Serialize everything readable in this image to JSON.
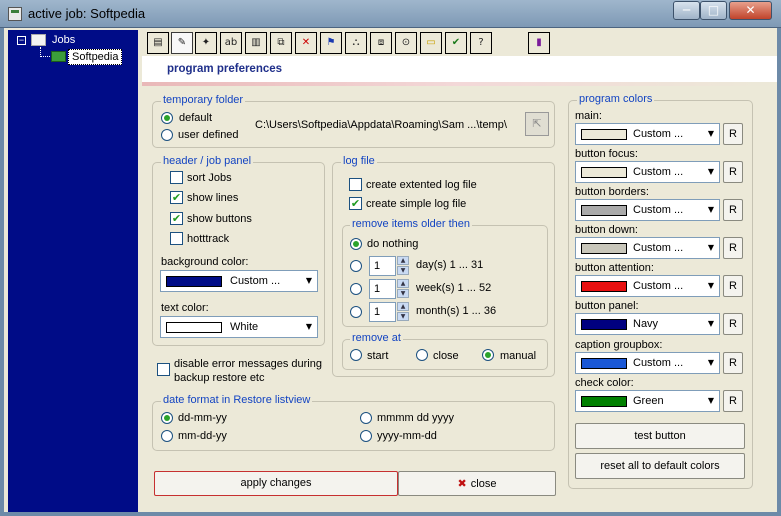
{
  "window": {
    "title": "active job: Softpedia",
    "min_symbol": "─",
    "max_symbol": "□",
    "close_symbol": "✕"
  },
  "tree": {
    "expander": "−",
    "root_label": "Jobs",
    "child_label": "Softpedia"
  },
  "toolbar": {
    "icons": [
      "list-icon",
      "edit-icon",
      "new-icon",
      "rename-icon",
      "save-icon",
      "copy-icon",
      "delete-icon",
      "run-icon",
      "tree-icon",
      "network-icon",
      "find-icon",
      "note-icon",
      "check-icon",
      "help-icon",
      "exit-icon"
    ],
    "glyphs": [
      "▤",
      "✎",
      "✦",
      "ab",
      "▥",
      "⧉",
      "✕",
      "⚑",
      "⛬",
      "⧈",
      "⊙",
      "▭",
      "✔",
      "?",
      "▮"
    ]
  },
  "header": {
    "title": "program preferences"
  },
  "temporary_folder": {
    "title": "temporary folder",
    "option_default": "default",
    "option_user": "user defined",
    "path": "C:\\Users\\Softpedia\\Appdata\\Roaming\\Sam ...\\temp\\",
    "browse_glyph": "⇱",
    "selected": "default"
  },
  "header_job_panel": {
    "title": "header / job panel",
    "sort_jobs": "sort Jobs",
    "show_lines": "show lines",
    "show_buttons": "show buttons",
    "hottrack": "hotttrack",
    "check_glyph": "✔",
    "background_color_label": "background color:",
    "background_color_value": "Custom ...",
    "background_color_hex": "#000c87",
    "text_color_label": "text color:",
    "text_color_value": "White",
    "text_color_hex": "#ffffff"
  },
  "log_file": {
    "title": "log file",
    "extended": "create extented log file",
    "simple": "create simple log file"
  },
  "remove_items": {
    "title": "remove items older then",
    "do_nothing": "do nothing",
    "days_value": "1",
    "days_label": "day(s) 1 ... 31",
    "weeks_value": "1",
    "weeks_label": "week(s) 1 ... 52",
    "months_value": "1",
    "months_label": "month(s) 1 ... 36",
    "spin_up": "▲",
    "spin_down": "▼"
  },
  "remove_at": {
    "title": "remove at",
    "start": "start",
    "close": "close",
    "manual": "manual"
  },
  "disable_errors": "disable error messages during backup restore etc",
  "date_format": {
    "title": "date format in Restore listview",
    "opt1": "dd-mm-yy",
    "opt2": "mm-dd-yy",
    "opt3": "mmmm dd yyyy",
    "opt4": "yyyy-mm-dd"
  },
  "actions": {
    "apply": "apply changes",
    "close": "close",
    "close_glyph": "✖"
  },
  "program_colors": {
    "title": "program colors",
    "dropdown_arrow": "▼",
    "reset_short": "R",
    "items": [
      {
        "label": "main:",
        "value": "Custom ...",
        "hex": "#ece9d8"
      },
      {
        "label": "button focus:",
        "value": "Custom ...",
        "hex": "#ece9d8"
      },
      {
        "label": "button borders:",
        "value": "Custom ...",
        "hex": "#aaaaaa"
      },
      {
        "label": "button down:",
        "value": "Custom ...",
        "hex": "#c8c6ba"
      },
      {
        "label": "button attention:",
        "value": "Custom ...",
        "hex": "#e81010"
      },
      {
        "label": "button panel:",
        "value": "Navy",
        "hex": "#000080"
      },
      {
        "label": "caption groupbox:",
        "value": "Custom ...",
        "hex": "#1a58d6"
      },
      {
        "label": "check color:",
        "value": "Green",
        "hex": "#008000"
      }
    ],
    "test_button": "test button",
    "reset_all": "reset all to default colors"
  }
}
